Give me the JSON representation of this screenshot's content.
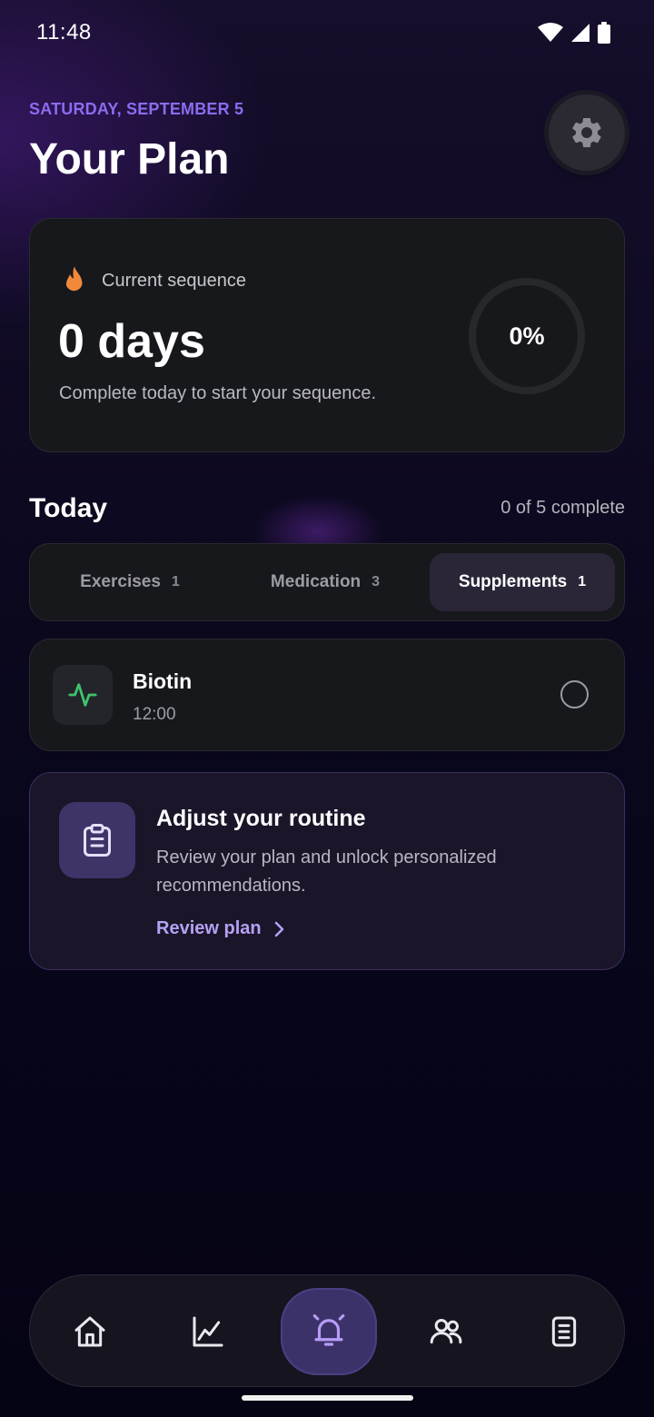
{
  "status_bar": {
    "time": "11:48"
  },
  "header": {
    "date": "SATURDAY, SEPTEMBER 5",
    "title": "Your Plan",
    "settings_icon": "gear-icon"
  },
  "sequence": {
    "label": "Current sequence",
    "value": "0 days",
    "hint": "Complete today to start your sequence.",
    "progress_text": "0%",
    "progress": 0
  },
  "today": {
    "title": "Today",
    "count": "0 of 5 complete",
    "tabs": [
      {
        "label": "Exercises",
        "count": "1",
        "active": false
      },
      {
        "label": "Medication",
        "count": "3",
        "active": false
      },
      {
        "label": "Supplements",
        "count": "1",
        "active": true
      }
    ],
    "items": [
      {
        "name": "Biotin",
        "time": "12:00",
        "icon": "activity-icon",
        "done": false
      }
    ]
  },
  "adjust": {
    "title": "Adjust your routine",
    "description": "Review your plan and unlock personalized recommendations.",
    "link": "Review plan"
  },
  "nav": {
    "items": [
      "home-icon",
      "chart-icon",
      "bell-icon",
      "users-icon",
      "notes-icon"
    ],
    "active": "bell-icon"
  },
  "colors": {
    "accent": "#8b6cf0",
    "flame": "#f08a3a",
    "pulse": "#3fc46b"
  }
}
